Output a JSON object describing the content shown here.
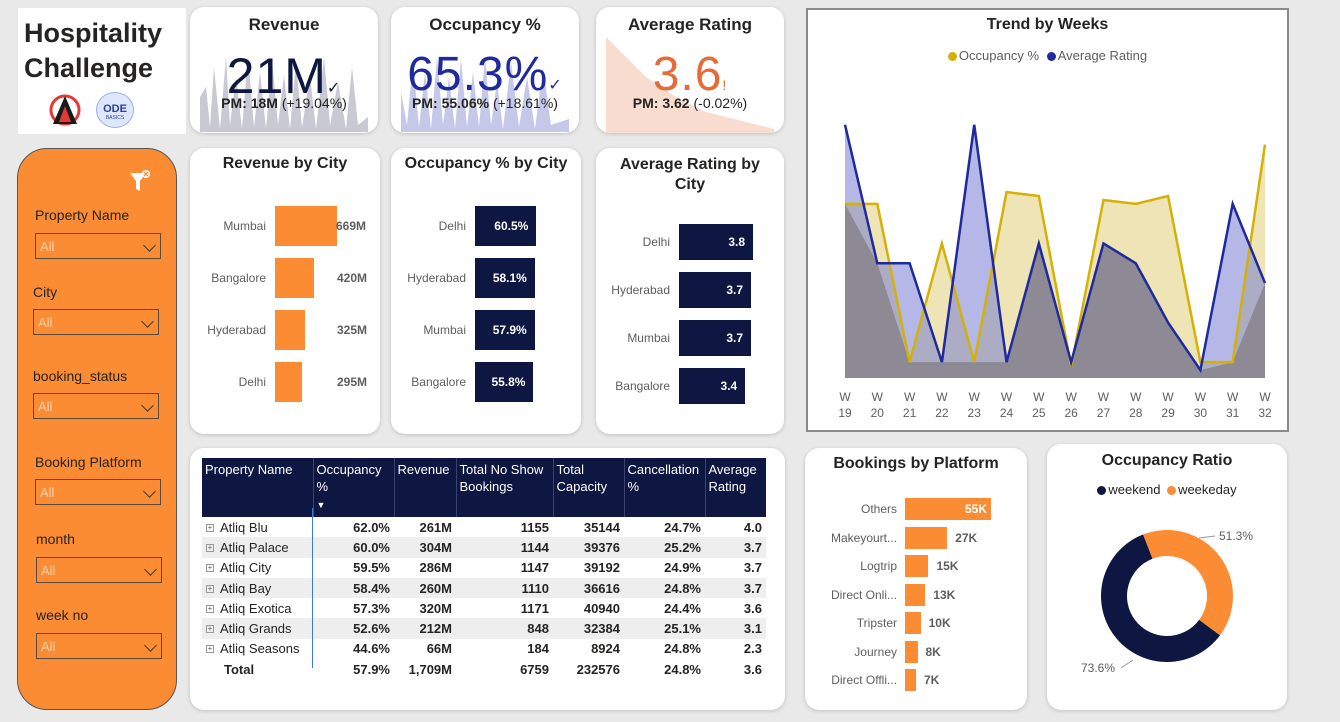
{
  "title_line1": "Hospitality",
  "title_line2": "Challenge",
  "logo_text": "ODE",
  "logo_subtext": "BASICS",
  "filters": [
    {
      "label": "Property Name",
      "value": "All"
    },
    {
      "label": "City",
      "value": "All"
    },
    {
      "label": "booking_status",
      "value": "All"
    },
    {
      "label": "Booking Platform",
      "value": "All"
    },
    {
      "label": "month",
      "value": "All"
    },
    {
      "label": "week no",
      "value": "All"
    }
  ],
  "kpis": {
    "revenue": {
      "title": "Revenue",
      "value": "21M",
      "pm_label": "PM: 18M",
      "pm_change": "(+19.04%)"
    },
    "occupancy": {
      "title": "Occupancy %",
      "value": "65.3%",
      "pm_label": "PM: 55.06%",
      "pm_change": "(+18.61%)"
    },
    "rating": {
      "title": "Average Rating",
      "value": "3.6",
      "pm_label": "PM: 3.62",
      "pm_change": "(-0.02%)"
    }
  },
  "colors": {
    "orange": "#fb8c34",
    "navy": "#0d1742",
    "gold": "#d4b106",
    "blue": "#1f2a9c",
    "rating_orange": "#e66b37"
  },
  "revenue_by_city": {
    "title": "Revenue by City",
    "chart_data": {
      "type": "bar",
      "categories": [
        "Mumbai",
        "Bangalore",
        "Hyderabad",
        "Delhi"
      ],
      "values": [
        669,
        420,
        325,
        295
      ],
      "labels": [
        "669M",
        "420M",
        "325M",
        "295M"
      ]
    }
  },
  "occupancy_by_city": {
    "title": "Occupancy % by City",
    "chart_data": {
      "type": "bar",
      "categories": [
        "Delhi",
        "Hyderabad",
        "Mumbai",
        "Bangalore"
      ],
      "values": [
        60.5,
        58.1,
        57.9,
        55.8
      ],
      "labels": [
        "60.5%",
        "58.1%",
        "57.9%",
        "55.8%"
      ]
    }
  },
  "rating_by_city": {
    "title": "Average Rating by City",
    "chart_data": {
      "type": "bar",
      "categories": [
        "Delhi",
        "Hyderabad",
        "Mumbai",
        "Bangalore"
      ],
      "values": [
        3.8,
        3.7,
        3.7,
        3.4
      ],
      "labels": [
        "3.8",
        "3.7",
        "3.7",
        "3.4"
      ]
    }
  },
  "trend": {
    "title": "Trend by Weeks",
    "legend": [
      "Occupancy %",
      "Average Rating"
    ],
    "chart_data": {
      "type": "area",
      "categories": [
        "W 19",
        "W 20",
        "W 21",
        "W 22",
        "W 23",
        "W 24",
        "W 25",
        "W 26",
        "W 27",
        "W 28",
        "W 29",
        "W 30",
        "W 31",
        "W 32"
      ],
      "series": [
        {
          "name": "Occupancy %",
          "values": [
            0.62,
            0.62,
            0.58,
            0.61,
            0.58,
            0.623,
            0.622,
            0.579,
            0.621,
            0.62,
            0.622,
            0.58,
            0.58,
            0.635
          ]
        },
        {
          "name": "Average Rating",
          "values": [
            0.64,
            0.605,
            0.605,
            0.58,
            0.64,
            0.58,
            0.61,
            0.58,
            0.61,
            0.605,
            0.59,
            0.578,
            0.62,
            0.6
          ]
        }
      ]
    }
  },
  "table": {
    "headers": [
      "Property Name",
      "Occupancy %",
      "Revenue",
      "Total No Show Bookings",
      "Total Capacity",
      "Cancellation %",
      "Average Rating"
    ],
    "rows": [
      [
        "Atliq Blu",
        "62.0%",
        "261M",
        "1155",
        "35144",
        "24.7%",
        "4.0"
      ],
      [
        "Atliq Palace",
        "60.0%",
        "304M",
        "1144",
        "39376",
        "25.2%",
        "3.7"
      ],
      [
        "Atliq City",
        "59.5%",
        "286M",
        "1147",
        "39192",
        "24.9%",
        "3.7"
      ],
      [
        "Atliq Bay",
        "58.4%",
        "260M",
        "1110",
        "36616",
        "24.8%",
        "3.7"
      ],
      [
        "Atliq Exotica",
        "57.3%",
        "320M",
        "1171",
        "40940",
        "24.4%",
        "3.6"
      ],
      [
        "Atliq Grands",
        "52.6%",
        "212M",
        "848",
        "32384",
        "25.1%",
        "3.1"
      ],
      [
        "Atliq Seasons",
        "44.6%",
        "66M",
        "184",
        "8924",
        "24.8%",
        "2.3"
      ]
    ],
    "total": [
      "Total",
      "57.9%",
      "1,709M",
      "6759",
      "232576",
      "24.8%",
      "3.6"
    ]
  },
  "platform": {
    "title": "Bookings by Platform",
    "chart_data": {
      "type": "bar",
      "categories": [
        "Others",
        "Makeyourt...",
        "Logtrip",
        "Direct Onli...",
        "Tripster",
        "Journey",
        "Direct Offli..."
      ],
      "values": [
        55,
        27,
        15,
        13,
        10,
        8,
        7
      ],
      "labels": [
        "55K",
        "27K",
        "15K",
        "13K",
        "10K",
        "8K",
        "7K"
      ]
    }
  },
  "occupancy_ratio": {
    "title": "Occupancy Ratio",
    "legend": [
      "weekend",
      "weekeday"
    ],
    "chart_data": {
      "type": "pie",
      "categories": [
        "weekend",
        "weekeday"
      ],
      "values": [
        73.6,
        51.3
      ],
      "labels": [
        "73.6%",
        "51.3%"
      ]
    }
  }
}
